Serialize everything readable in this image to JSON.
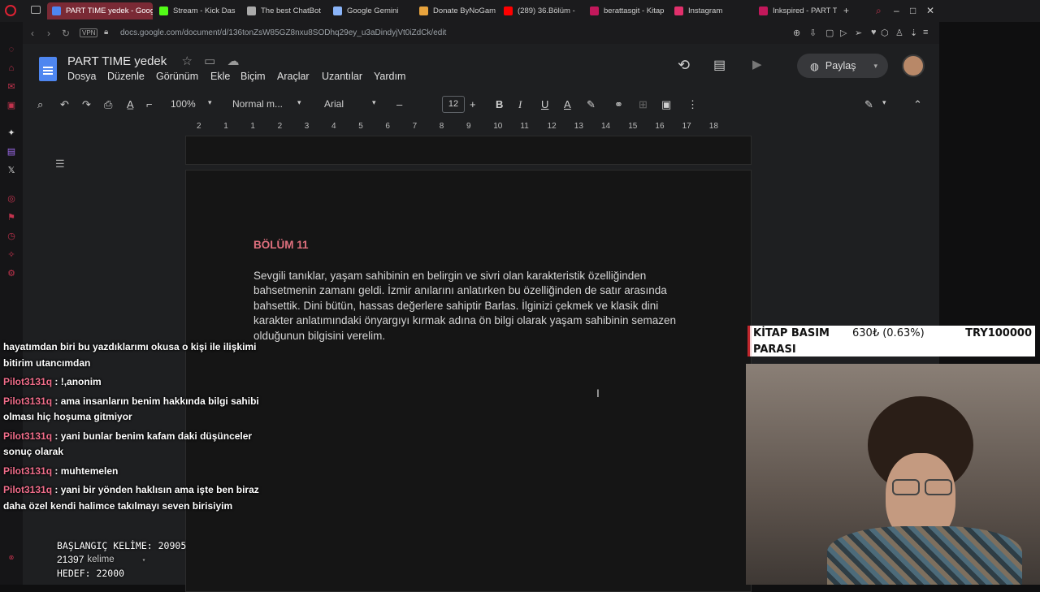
{
  "browser": {
    "tabs": [
      {
        "label": "PART TIME yedek - Goog",
        "color": "#4e86f0",
        "active": true
      },
      {
        "label": "Stream - Kick Das",
        "color": "#53fc18"
      },
      {
        "label": "The best ChatBot",
        "color": "#aaaaaa"
      },
      {
        "label": "Google Gemini",
        "color": "#8ab4f8"
      },
      {
        "label": "Donate ByNoGam",
        "color": "#e8a33d"
      },
      {
        "label": "(289) 36.Bölüm -",
        "color": "#ff0000"
      },
      {
        "label": "berattasgit - Kitap",
        "color": "#c2185b"
      },
      {
        "label": "Instagram",
        "color": "#e1306c"
      },
      {
        "label": "Inkspired - PART T",
        "color": "#c2185b"
      }
    ],
    "url": "docs.google.com/document/d/136tonZsW85GZ8nxu8SODhq29ey_u3aDindyjVt0iZdCk/edit",
    "vpn_label": "VPN"
  },
  "doc": {
    "title": "PART TIME  yedek",
    "menus": [
      "Dosya",
      "Düzenle",
      "Görünüm",
      "Ekle",
      "Biçim",
      "Araçlar",
      "Uzantılar",
      "Yardım"
    ],
    "share_label": "Paylaş",
    "zoom": "100%",
    "style": "Normal m...",
    "font": "Arial",
    "font_size": "12",
    "ruler": [
      "2",
      "1",
      "1",
      "2",
      "3",
      "4",
      "5",
      "6",
      "7",
      "8",
      "9",
      "10",
      "11",
      "12",
      "13",
      "14",
      "15",
      "16",
      "17",
      "18"
    ],
    "chapter": "BÖLÜM 11",
    "paragraph": "Sevgili tanıklar, yaşam sahibinin en belirgin ve sivri olan karakteristik özelliğinden bahsetmenin zamanı geldi. İzmir anılarını anlatırken bu özelliğinden de satır arasında bahsettik. Dini bütün, hassas değerlere sahiptir Barlas. İlginizi çekmek ve klasik dini karakter anlatımındaki önyargıyı kırmak adına ön bilgi olarak yaşam sahibinin semazen olduğunun bilgisini verelim."
  },
  "chat": {
    "fragment": "hayatımdan biri bu yazdıklarımı okusa o kişi ile ilişkimi bitirim utancımdan",
    "messages": [
      {
        "user": "Pilot3131q",
        "text": " : !,anonim"
      },
      {
        "user": "Pilot3131q",
        "text": " : ama insanların benim hakkında bilgi sahibi olması hiç hoşuma gitmiyor"
      },
      {
        "user": "Pilot3131q",
        "text": " : yani bunlar benim kafam daki düşünceler sonuç olarak"
      },
      {
        "user": "Pilot3131q",
        "text": " : muhtemelen"
      },
      {
        "user": "Pilot3131q",
        "text": " : yani bir yönden haklısın ama işte ben biraz daha özel kendi halimce takılmayı seven birisiyim"
      }
    ]
  },
  "counter": {
    "start": "BAŞLANGIÇ KELİME: 20905",
    "words": "21397",
    "words_unit": "kelime",
    "goal": "HEDEF: 22000"
  },
  "goal_widget": {
    "label_line1": "KİTAP BASIM",
    "label_line2": "PARASI",
    "current": "630₺ (0.63%)",
    "target": "TRY100000",
    "progress_percent": 0.63
  }
}
